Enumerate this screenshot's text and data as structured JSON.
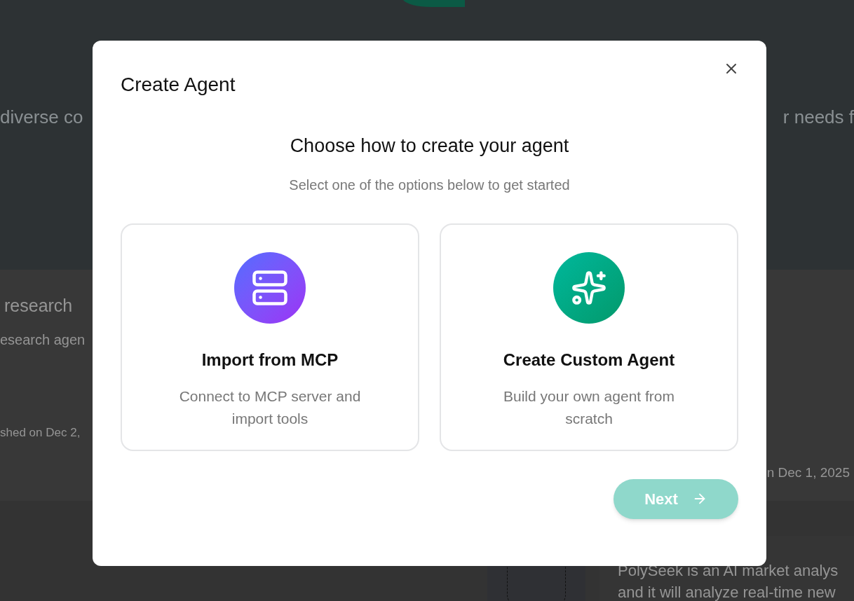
{
  "background": {
    "intro_left": "diverse co",
    "intro_right": "r needs f",
    "cards": [
      {
        "title": "research",
        "description": "esearch agen",
        "published": "shed on Dec 2,"
      },
      {
        "published": "n Dec 1, 2025"
      }
    ],
    "lower_card": {
      "description_lines": [
        "PolySeek is an AI market analys",
        "and it will analyze real-time new"
      ]
    }
  },
  "dialog": {
    "title": "Create Agent",
    "heading": "Choose how to create your agent",
    "subtitle": "Select one of the options below to get started",
    "options": [
      {
        "kind": "mcp",
        "title": "Import from MCP",
        "description": "Connect to MCP server and import tools",
        "selected": false
      },
      {
        "kind": "custom",
        "title": "Create Custom Agent",
        "description": "Build your own agent from scratch",
        "selected": false
      }
    ],
    "next_button": {
      "label": "Next",
      "disabled": true
    }
  }
}
